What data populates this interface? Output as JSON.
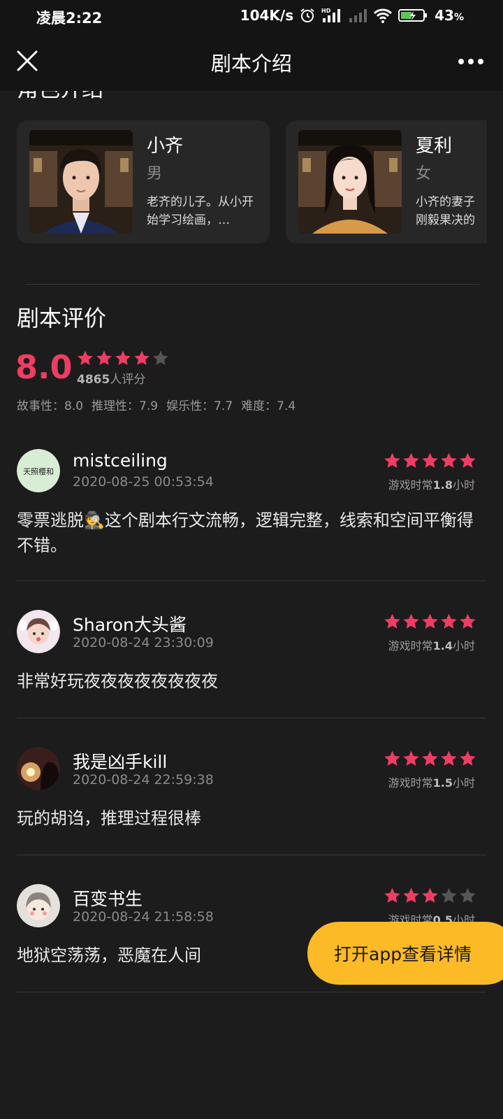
{
  "status_bar": {
    "time": "凌晨2:22",
    "speed": "104K/s",
    "battery": "43",
    "battery_unit": "%",
    "icons": [
      "alarm-icon",
      "hd-signal-icon",
      "signal-icon",
      "wifi-icon",
      "battery-charging-icon"
    ]
  },
  "nav": {
    "title": "剧本介绍",
    "close_icon": "close-icon",
    "more_icon": "more-icon"
  },
  "roles": {
    "section_title": "角色介绍",
    "items": [
      {
        "name": "小齐",
        "gender": "男",
        "desc": "老齐的儿子。从小开始学习绘画，…"
      },
      {
        "name": "夏利",
        "gender": "女",
        "desc": "小齐的妻子刚毅果决的"
      }
    ]
  },
  "rating": {
    "section_title": "剧本评价",
    "score": "8.0",
    "stars": 4,
    "count": "4865",
    "count_suffix": "人评分",
    "sub_scores": [
      "故事性：8.0",
      "推理性：7.9",
      "娱乐性：7.7",
      "难度：7.4"
    ]
  },
  "reviews": [
    {
      "user": "mistceiling",
      "avatar_text": "天照樱和",
      "time": "2020-08-25 00:53:54",
      "stars": 5,
      "play_prefix": "游戏时常",
      "play_value": "1.8",
      "play_suffix": "小时",
      "text": "零票逃脱🕵️这个剧本行文流畅，逻辑完整，线索和空间平衡得不错。"
    },
    {
      "user": "Sharon大头酱",
      "time": "2020-08-24 23:30:09",
      "stars": 5,
      "play_prefix": "游戏时常",
      "play_value": "1.4",
      "play_suffix": "小时",
      "text": "非常好玩夜夜夜夜夜夜夜夜"
    },
    {
      "user": "我是凶手kill",
      "time": "2020-08-24 22:59:38",
      "stars": 5,
      "play_prefix": "游戏时常",
      "play_value": "1.5",
      "play_suffix": "小时",
      "text": "玩的胡诌，推理过程很棒"
    },
    {
      "user": "百变书生",
      "time": "2020-08-24 21:58:58",
      "stars": 3,
      "play_prefix": "游戏时常",
      "play_value": "0.5",
      "play_suffix": "小时",
      "text": "地狱空荡荡，恶魔在人间"
    }
  ],
  "open_app_button": "打开app查看详情",
  "colors": {
    "accent": "#ee3d63",
    "star_empty": "#555555",
    "button": "#fbba26",
    "background": "#1c1c1c"
  }
}
